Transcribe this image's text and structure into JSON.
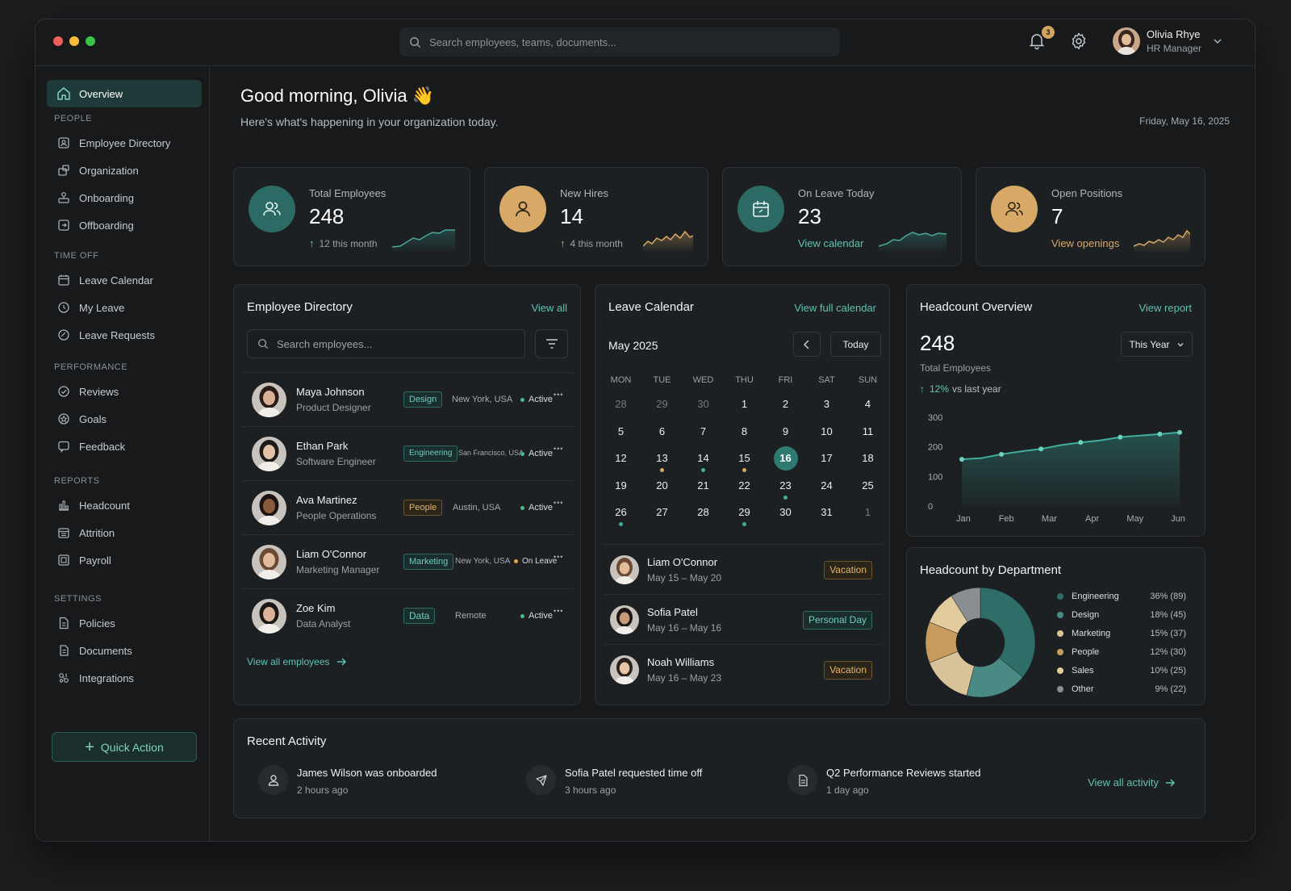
{
  "colors": {
    "accent": "#5fc2b1",
    "teal": "#2c6b65",
    "gold": "#d7a866",
    "active_dot": "#3fbf8a",
    "leave_dot": "#e3a444"
  },
  "topbar": {
    "search_placeholder": "Search employees, teams, documents...",
    "notification_count": "3",
    "user_name": "Olivia Rhye",
    "user_role": "HR Manager"
  },
  "sidebar": {
    "active": "Overview",
    "sections": [
      {
        "title": "PEOPLE",
        "items": [
          {
            "label": "Employee Directory",
            "icon": "id-card-icon"
          },
          {
            "label": "Organization",
            "icon": "org-icon"
          },
          {
            "label": "Onboarding",
            "icon": "onboarding-icon"
          },
          {
            "label": "Offboarding",
            "icon": "offboarding-icon"
          }
        ]
      },
      {
        "title": "TIME OFF",
        "items": [
          {
            "label": "Leave Calendar",
            "icon": "calendar-icon"
          },
          {
            "label": "My Leave",
            "icon": "clock-icon"
          },
          {
            "label": "Leave Requests",
            "icon": "requests-icon"
          }
        ]
      },
      {
        "title": "PERFORMANCE",
        "items": [
          {
            "label": "Reviews",
            "icon": "check-circle-icon"
          },
          {
            "label": "Goals",
            "icon": "target-icon"
          },
          {
            "label": "Feedback",
            "icon": "chat-icon"
          }
        ]
      },
      {
        "title": "REPORTS",
        "items": [
          {
            "label": "Headcount",
            "icon": "bar-chart-icon"
          },
          {
            "label": "Attrition",
            "icon": "calendar-x-icon"
          },
          {
            "label": "Payroll",
            "icon": "payroll-icon"
          }
        ]
      },
      {
        "title": "SETTINGS",
        "items": [
          {
            "label": "Policies",
            "icon": "document-icon"
          },
          {
            "label": "Documents",
            "icon": "files-icon"
          },
          {
            "label": "Integrations",
            "icon": "puzzle-icon"
          }
        ]
      }
    ],
    "quick_action": "Quick Action"
  },
  "header": {
    "greeting": "Good morning, Olivia 👋",
    "subtitle": "Here's what's happening in your organization today.",
    "date": "Friday, May 16, 2025"
  },
  "stats": [
    {
      "label": "Total Employees",
      "value": "248",
      "sub": "12 this month",
      "icon": "users-icon"
    },
    {
      "label": "New Hires",
      "value": "14",
      "sub": "4 this month",
      "icon": "user-icon"
    },
    {
      "label": "On Leave Today",
      "value": "23",
      "link": "View calendar",
      "icon": "calendar-icon"
    },
    {
      "label": "Open Positions",
      "value": "7",
      "link": "View openings",
      "icon": "users-icon"
    }
  ],
  "directory": {
    "title": "Employee Directory",
    "view_all": "View all",
    "search_placeholder": "Search employees...",
    "employees": [
      {
        "name": "Maya Johnson",
        "role": "Product Designer",
        "dept": "Design",
        "location": "New York, USA",
        "status": "Active"
      },
      {
        "name": "Ethan Park",
        "role": "Software Engineer",
        "dept": "Engineering",
        "location": "San Francisco, USA",
        "status": "Active"
      },
      {
        "name": "Ava Martinez",
        "role": "People Operations",
        "dept": "People",
        "location": "Austin, USA",
        "status": "Active"
      },
      {
        "name": "Liam O'Connor",
        "role": "Marketing Manager",
        "dept": "Marketing",
        "location": "New York, USA",
        "status": "On Leave"
      },
      {
        "name": "Zoe Kim",
        "role": "Data Analyst",
        "dept": "Data",
        "location": "Remote",
        "status": "Active"
      }
    ],
    "footer_link": "View all employees"
  },
  "calendar": {
    "title": "Leave Calendar",
    "link": "View full calendar",
    "month": "May 2025",
    "today_btn": "Today",
    "days_of_week": [
      "MON",
      "TUE",
      "WED",
      "THU",
      "FRI",
      "SAT",
      "SUN"
    ],
    "weeks": [
      [
        "28",
        "29",
        "30",
        "1",
        "2",
        "3",
        "4"
      ],
      [
        "5",
        "6",
        "7",
        "8",
        "9",
        "10",
        "11"
      ],
      [
        "12",
        "13",
        "14",
        "15",
        "16",
        "17",
        "18"
      ],
      [
        "19",
        "20",
        "21",
        "22",
        "23",
        "24",
        "25"
      ],
      [
        "26",
        "27",
        "28",
        "29",
        "30",
        "31",
        "1"
      ]
    ],
    "leaves": [
      {
        "name": "Liam O'Connor",
        "dates": "May 15 – May 20",
        "type": "Vacation"
      },
      {
        "name": "Sofia Patel",
        "dates": "May 16 – May 16",
        "type": "Personal Day"
      },
      {
        "name": "Noah Williams",
        "dates": "May 16 – May 23",
        "type": "Vacation"
      }
    ]
  },
  "headcount": {
    "title": "Headcount Overview",
    "link": "View report",
    "value": "248",
    "label": "Total Employees",
    "change_pct": "12%",
    "change_text": "vs last year",
    "period": "This Year"
  },
  "chart_data": {
    "type": "area",
    "categories": [
      "Jan",
      "Feb",
      "Mar",
      "Apr",
      "May",
      "Jun"
    ],
    "series": [
      {
        "values": [
          158,
          162,
          175,
          185,
          193,
          206,
          215,
          222,
          233,
          238,
          243,
          249
        ]
      }
    ],
    "ylim": [
      0,
      300
    ],
    "yticks": [
      "300",
      "200",
      "100",
      "0"
    ],
    "grid": false
  },
  "departments": {
    "title": "Headcount by Department",
    "items": [
      {
        "name": "Engineering",
        "pct": "36% (89)",
        "value": 89,
        "color": "#2f6e68"
      },
      {
        "name": "Design",
        "pct": "18% (45)",
        "value": 45,
        "color": "#4a8a84"
      },
      {
        "name": "Marketing",
        "pct": "15% (37)",
        "value": 37,
        "color": "#d9c39a"
      },
      {
        "name": "People",
        "pct": "12% (30)",
        "value": 30,
        "color": "#c89a5c"
      },
      {
        "name": "Sales",
        "pct": "10% (25)",
        "value": 25,
        "color": "#e2cc9f"
      },
      {
        "name": "Other",
        "pct": "9% (22)",
        "value": 22,
        "color": "#8a8e92"
      }
    ]
  },
  "activity": {
    "title": "Recent Activity",
    "items": [
      {
        "text": "James Wilson was onboarded",
        "time": "2 hours ago",
        "icon": "user-icon"
      },
      {
        "text": "Sofia Patel requested time off",
        "time": "3 hours ago",
        "icon": "plane-icon"
      },
      {
        "text": "Q2 Performance Reviews started",
        "time": "1 day ago",
        "icon": "document-icon"
      }
    ],
    "view_all": "View all activity"
  }
}
